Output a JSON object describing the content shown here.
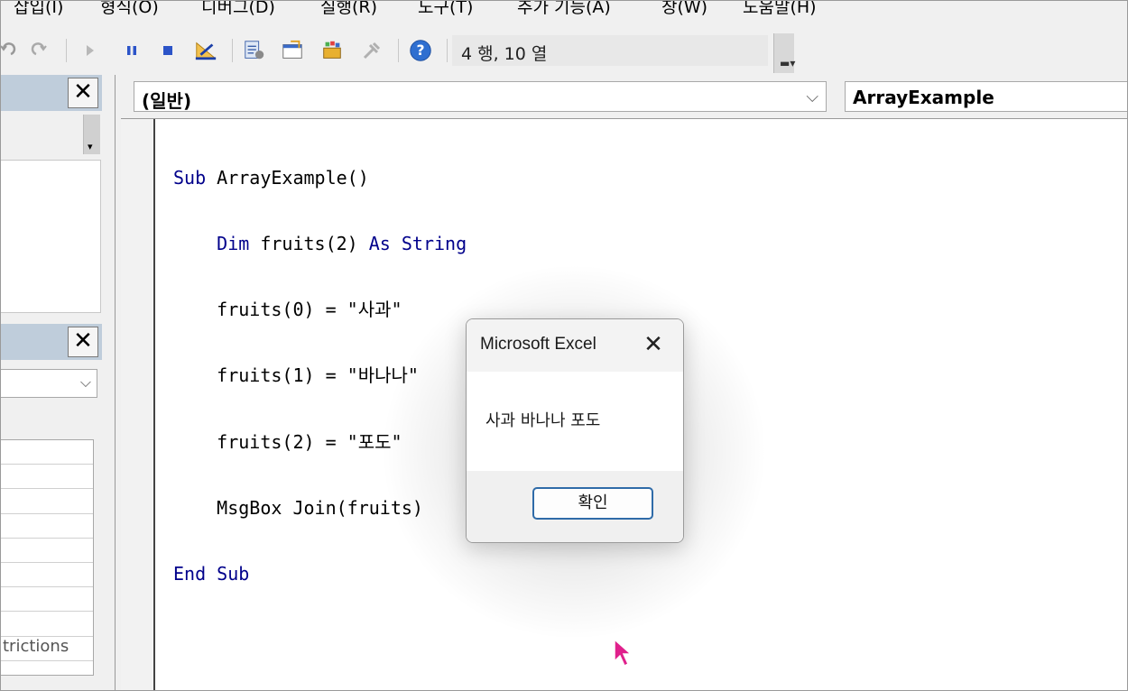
{
  "menu": {
    "items": [
      "삽입(I)",
      "형식(O)",
      "디버그(D)",
      "실행(R)",
      "도구(T)",
      "추가 기능(A)",
      "창(W)",
      "도움말(H)"
    ]
  },
  "toolbar": {
    "icons": [
      "undo-icon",
      "redo-icon",
      "run-icon",
      "break-icon",
      "reset-icon",
      "design-mode-icon",
      "project-explorer-icon",
      "properties-icon",
      "object-browser-icon",
      "toolbox-icon",
      "help-icon"
    ],
    "cursor_position": "4 행, 10 열"
  },
  "left_panel": {
    "property_partial_text": "trictions"
  },
  "code_window": {
    "object_dropdown": "(일반)",
    "procedure_dropdown": "ArrayExample",
    "lines": [
      {
        "kw": "Sub",
        "text": " ArrayExample()"
      },
      {
        "indent": "    ",
        "kw": "Dim",
        "text": " fruits(2) ",
        "kw2": "As",
        "text2": " ",
        "kw3": "String"
      },
      {
        "indent": "    ",
        "text": "fruits(0) = \"사과\""
      },
      {
        "indent": "    ",
        "text": "fruits(1) = \"바나나\""
      },
      {
        "indent": "    ",
        "text": "fruits(2) = \"포도\""
      },
      {
        "indent": "    ",
        "text": "MsgBox Join(fruits)"
      },
      {
        "kw": "End",
        "text": " ",
        "kw2": "Sub"
      }
    ]
  },
  "msgbox": {
    "title": "Microsoft Excel",
    "message": "사과 바나나 포도",
    "ok_label": "확인"
  },
  "colors": {
    "keyword": "#00008b",
    "panel_header": "#bfcddb",
    "ok_border": "#2f6ba8",
    "cursor": "#e0208c"
  }
}
